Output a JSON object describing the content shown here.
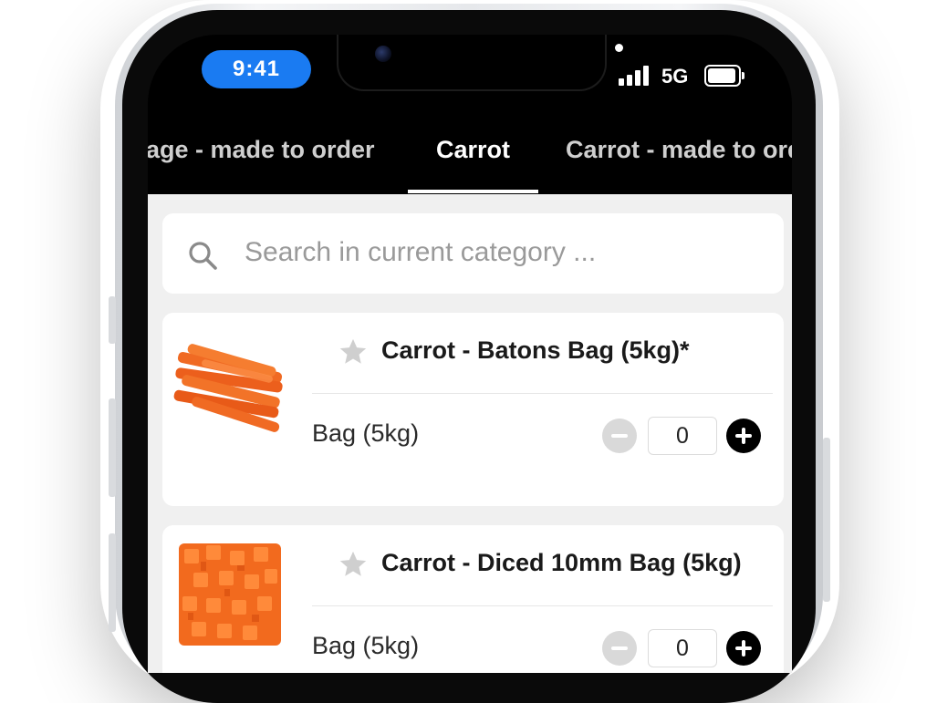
{
  "status_bar": {
    "time": "9:41",
    "network": "5G"
  },
  "tabs": [
    {
      "label": "age - made to order",
      "active": false
    },
    {
      "label": "Carrot",
      "active": true
    },
    {
      "label": "Carrot - made to order",
      "active": false
    }
  ],
  "search": {
    "placeholder": "Search in current category ..."
  },
  "products": [
    {
      "title": "Carrot - Batons Bag (5kg)*",
      "image": "carrot-batons-image",
      "unit_label": "Bag (5kg)",
      "quantity": "0"
    },
    {
      "title": "Carrot - Diced 10mm Bag (5kg)",
      "image": "carrot-diced-image",
      "unit_label": "Bag (5kg)",
      "quantity": "0"
    }
  ],
  "icons": {
    "search": "search-icon",
    "favorite": "star-icon",
    "decrement": "minus-icon",
    "increment": "plus-icon"
  },
  "colors": {
    "time_pill": "#1a7bf2",
    "tab_bar": "#000000",
    "background": "#f0f0f0",
    "carrot": "#f0641e"
  }
}
